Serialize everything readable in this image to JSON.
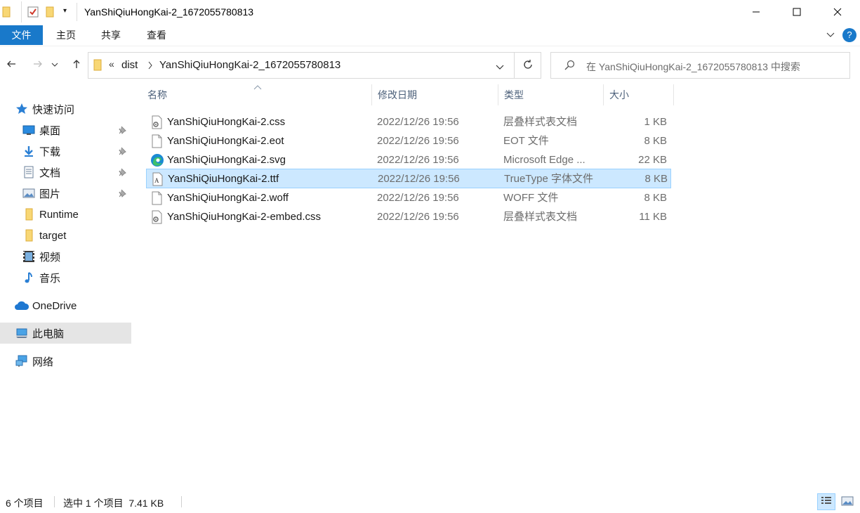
{
  "window": {
    "title": "YanShiQiuHongKai-2_1672055780813",
    "minimize_icon": "minimize-icon",
    "maximize_icon": "maximize-icon",
    "close_icon": "close-icon"
  },
  "ribbon": {
    "tabs": [
      {
        "label": "文件"
      },
      {
        "label": "主页"
      },
      {
        "label": "共享"
      },
      {
        "label": "查看"
      }
    ],
    "accent": "#1979ca"
  },
  "address": {
    "overflow": "«",
    "crumbs": [
      "dist",
      "YanShiQiuHongKai-2_1672055780813"
    ]
  },
  "search": {
    "placeholder": "在 YanShiQiuHongKai-2_1672055780813 中搜索"
  },
  "sidebar": {
    "items": [
      {
        "label": "快速访问",
        "icon": "star-icon"
      },
      {
        "label": "桌面",
        "icon": "desktop-icon",
        "pinned": true
      },
      {
        "label": "下载",
        "icon": "download-icon",
        "pinned": true
      },
      {
        "label": "文档",
        "icon": "document-icon",
        "pinned": true
      },
      {
        "label": "图片",
        "icon": "pictures-icon",
        "pinned": true
      },
      {
        "label": "Runtime",
        "icon": "folder-icon"
      },
      {
        "label": "target",
        "icon": "folder-icon"
      },
      {
        "label": "视频",
        "icon": "video-icon"
      },
      {
        "label": "音乐",
        "icon": "music-icon"
      },
      {
        "label": "OneDrive",
        "icon": "cloud-icon"
      },
      {
        "label": "此电脑",
        "icon": "computer-icon",
        "selected": true
      },
      {
        "label": "网络",
        "icon": "network-icon"
      }
    ]
  },
  "columns": {
    "name": "名称",
    "date": "修改日期",
    "type": "类型",
    "size": "大小"
  },
  "files": [
    {
      "name": "YanShiQiuHongKai-2.css",
      "date": "2022/12/26 19:56",
      "type": "层叠样式表文档",
      "size": "1 KB",
      "icon": "css-file-icon"
    },
    {
      "name": "YanShiQiuHongKai-2.eot",
      "date": "2022/12/26 19:56",
      "type": "EOT 文件",
      "size": "8 KB",
      "icon": "blank-file-icon"
    },
    {
      "name": "YanShiQiuHongKai-2.svg",
      "date": "2022/12/26 19:56",
      "type": "Microsoft Edge ...",
      "size": "22 KB",
      "icon": "edge-icon"
    },
    {
      "name": "YanShiQiuHongKai-2.ttf",
      "date": "2022/12/26 19:56",
      "type": "TrueType 字体文件",
      "size": "8 KB",
      "icon": "font-file-icon",
      "selected": true
    },
    {
      "name": "YanShiQiuHongKai-2.woff",
      "date": "2022/12/26 19:56",
      "type": "WOFF 文件",
      "size": "8 KB",
      "icon": "blank-file-icon"
    },
    {
      "name": "YanShiQiuHongKai-2-embed.css",
      "date": "2022/12/26 19:56",
      "type": "层叠样式表文档",
      "size": "11 KB",
      "icon": "css-file-icon"
    }
  ],
  "status": {
    "count": "6 个项目",
    "selection": "选中 1 个项目  7.41 KB"
  }
}
